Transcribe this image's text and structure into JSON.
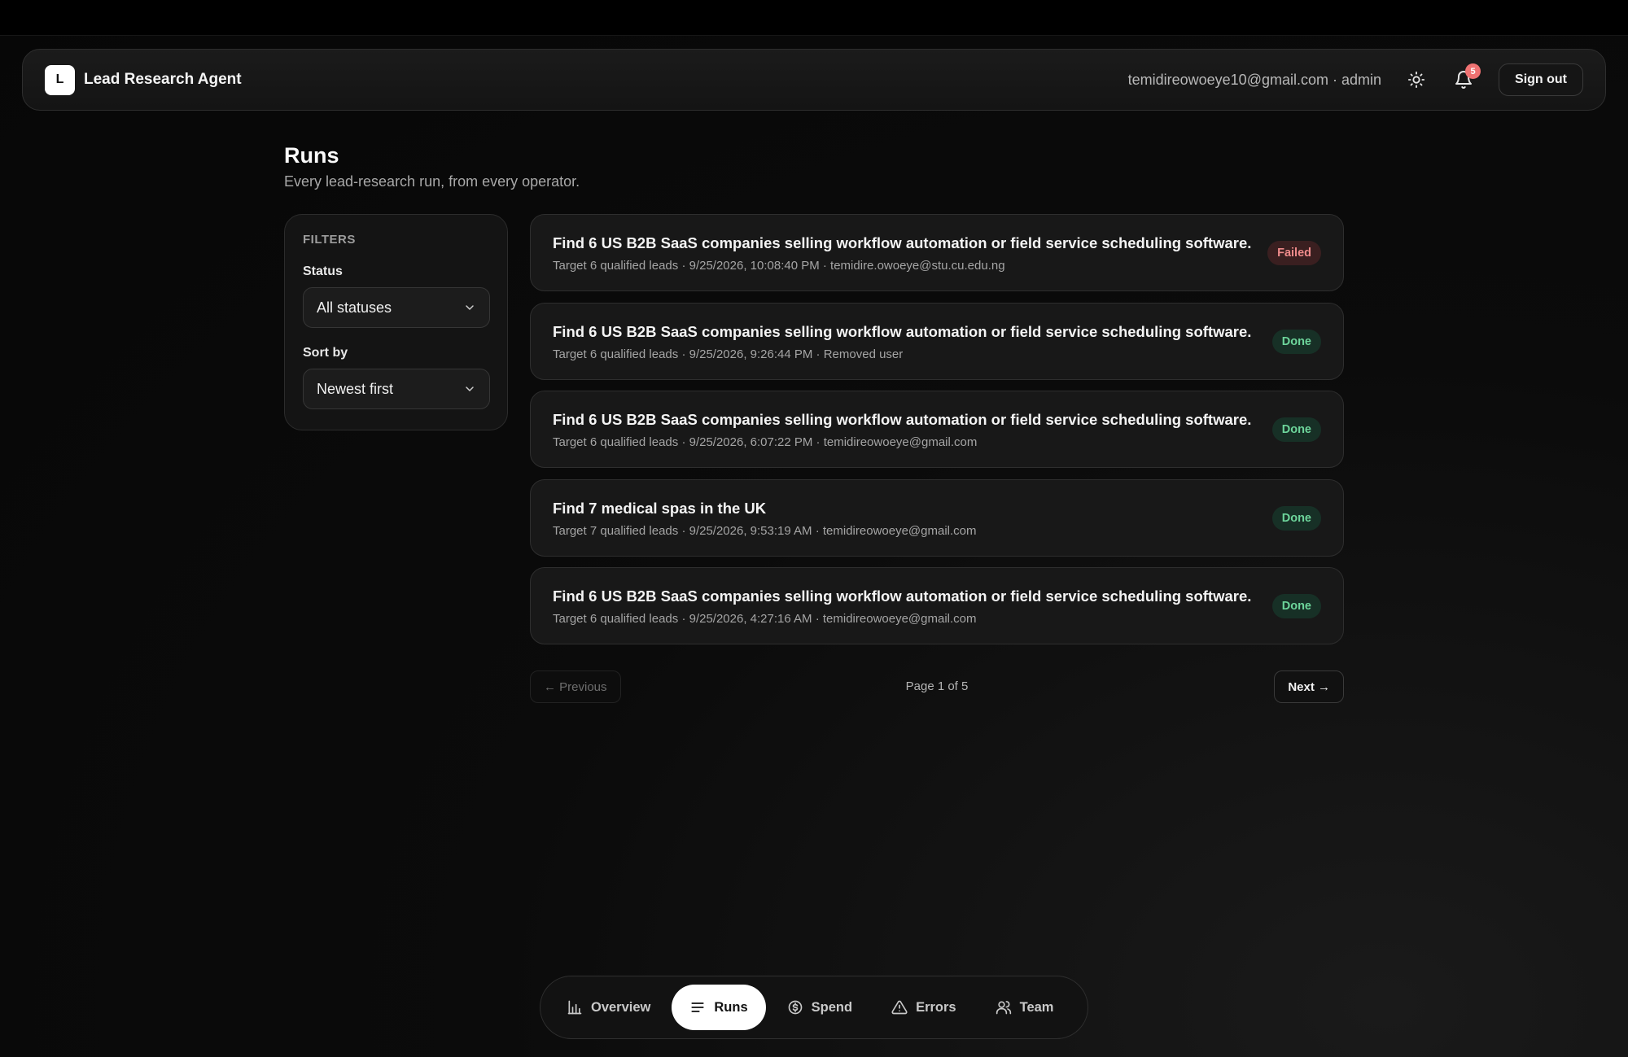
{
  "app": {
    "logo_letter": "L",
    "title": "Lead Research Agent"
  },
  "header": {
    "user_info": "temidireowoeye10@gmail.com · admin",
    "notification_count": "5",
    "sign_out_label": "Sign out",
    "icons": [
      "sun-icon",
      "bell-icon"
    ]
  },
  "page": {
    "title": "Runs",
    "subtitle": "Every lead-research run, from every operator."
  },
  "filters": {
    "heading": "FILTERS",
    "status_label": "Status",
    "status_value": "All statuses",
    "sort_label": "Sort by",
    "sort_value": "Newest first"
  },
  "runs": [
    {
      "title": "Find 6 US B2B SaaS companies selling workflow automation or field service scheduling software.",
      "meta": "Target 6 qualified leads · 9/25/2026, 10:08:40 PM · temidire.owoeye@stu.cu.edu.ng",
      "status": "Failed"
    },
    {
      "title": "Find 6 US B2B SaaS companies selling workflow automation or field service scheduling software.",
      "meta": "Target 6 qualified leads · 9/25/2026, 9:26:44 PM · Removed user",
      "status": "Done"
    },
    {
      "title": "Find 6 US B2B SaaS companies selling workflow automation or field service scheduling software.",
      "meta": "Target 6 qualified leads · 9/25/2026, 6:07:22 PM · temidireowoeye@gmail.com",
      "status": "Done"
    },
    {
      "title": "Find 7 medical spas in the UK",
      "meta": "Target 7 qualified leads · 9/25/2026, 9:53:19 AM · temidireowoeye@gmail.com",
      "status": "Done"
    },
    {
      "title": "Find 6 US B2B SaaS companies selling workflow automation or field service scheduling software.",
      "meta": "Target 6 qualified leads · 9/25/2026, 4:27:16 AM · temidireowoeye@gmail.com",
      "status": "Done"
    }
  ],
  "pagination": {
    "previous_label": "← Previous",
    "page_indicator": "Page 1 of 5",
    "next_label": "Next →"
  },
  "nav": {
    "items": [
      {
        "label": "Overview",
        "icon": "bar-chart-icon",
        "active": false
      },
      {
        "label": "Runs",
        "icon": "list-icon",
        "active": true
      },
      {
        "label": "Spend",
        "icon": "dollar-circle-icon",
        "active": false
      },
      {
        "label": "Errors",
        "icon": "warning-triangle-icon",
        "active": false
      },
      {
        "label": "Team",
        "icon": "users-icon",
        "active": false
      }
    ]
  },
  "colors": {
    "failed_text": "#ef8b8b",
    "failed_bg": "#3a1f20",
    "done_text": "#6dd59b",
    "done_bg": "#173026",
    "badge": "#f07272"
  }
}
